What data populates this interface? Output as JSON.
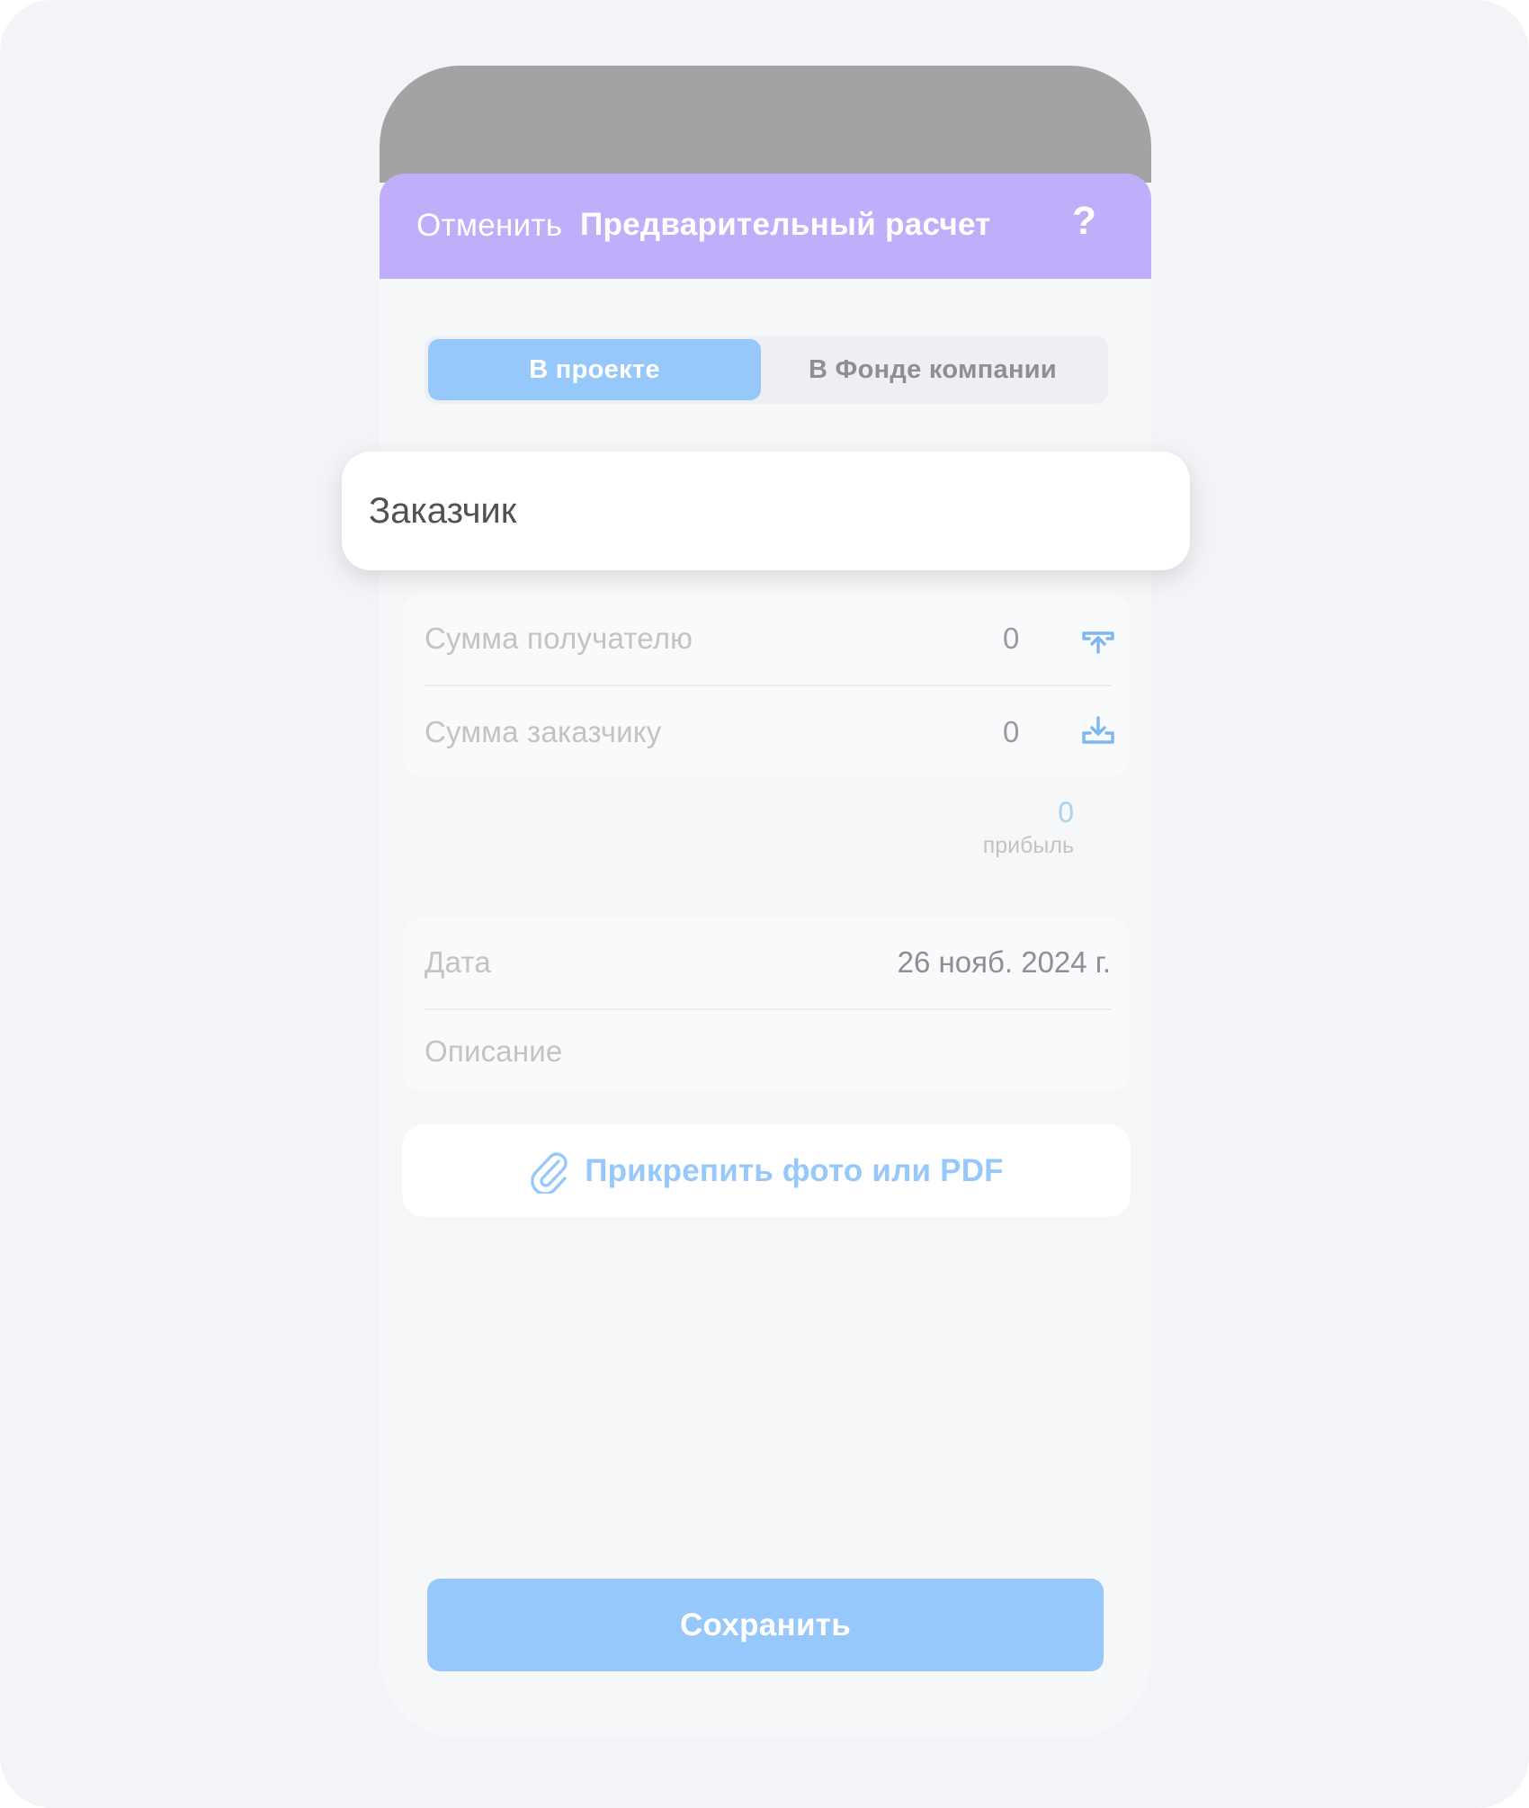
{
  "header": {
    "cancel_label": "Отменить",
    "title": "Предварительный расчет",
    "help_label": "?"
  },
  "segments": [
    {
      "label": "В проекте",
      "active": true
    },
    {
      "label": "В Фонде компании",
      "active": false
    }
  ],
  "popup": {
    "text": "Заказчик"
  },
  "amounts": {
    "recipient_label": "Сумма получателю",
    "recipient_value": "0",
    "recipient_icon": "upload-icon",
    "customer_label": "Сумма заказчику",
    "customer_value": "0",
    "customer_icon": "download-icon"
  },
  "profit": {
    "value": "0",
    "label": "прибыль"
  },
  "details": {
    "date_label": "Дата",
    "date_value": "26 нояб. 2024 г.",
    "description_label": "Описание"
  },
  "attach": {
    "icon": "paperclip-icon",
    "label": "Прикрепить фото или PDF"
  },
  "save_label": "Сохранить",
  "colors": {
    "header": "#c1aefa",
    "accent": "#97c8fb",
    "background": "#f3f4f8"
  }
}
